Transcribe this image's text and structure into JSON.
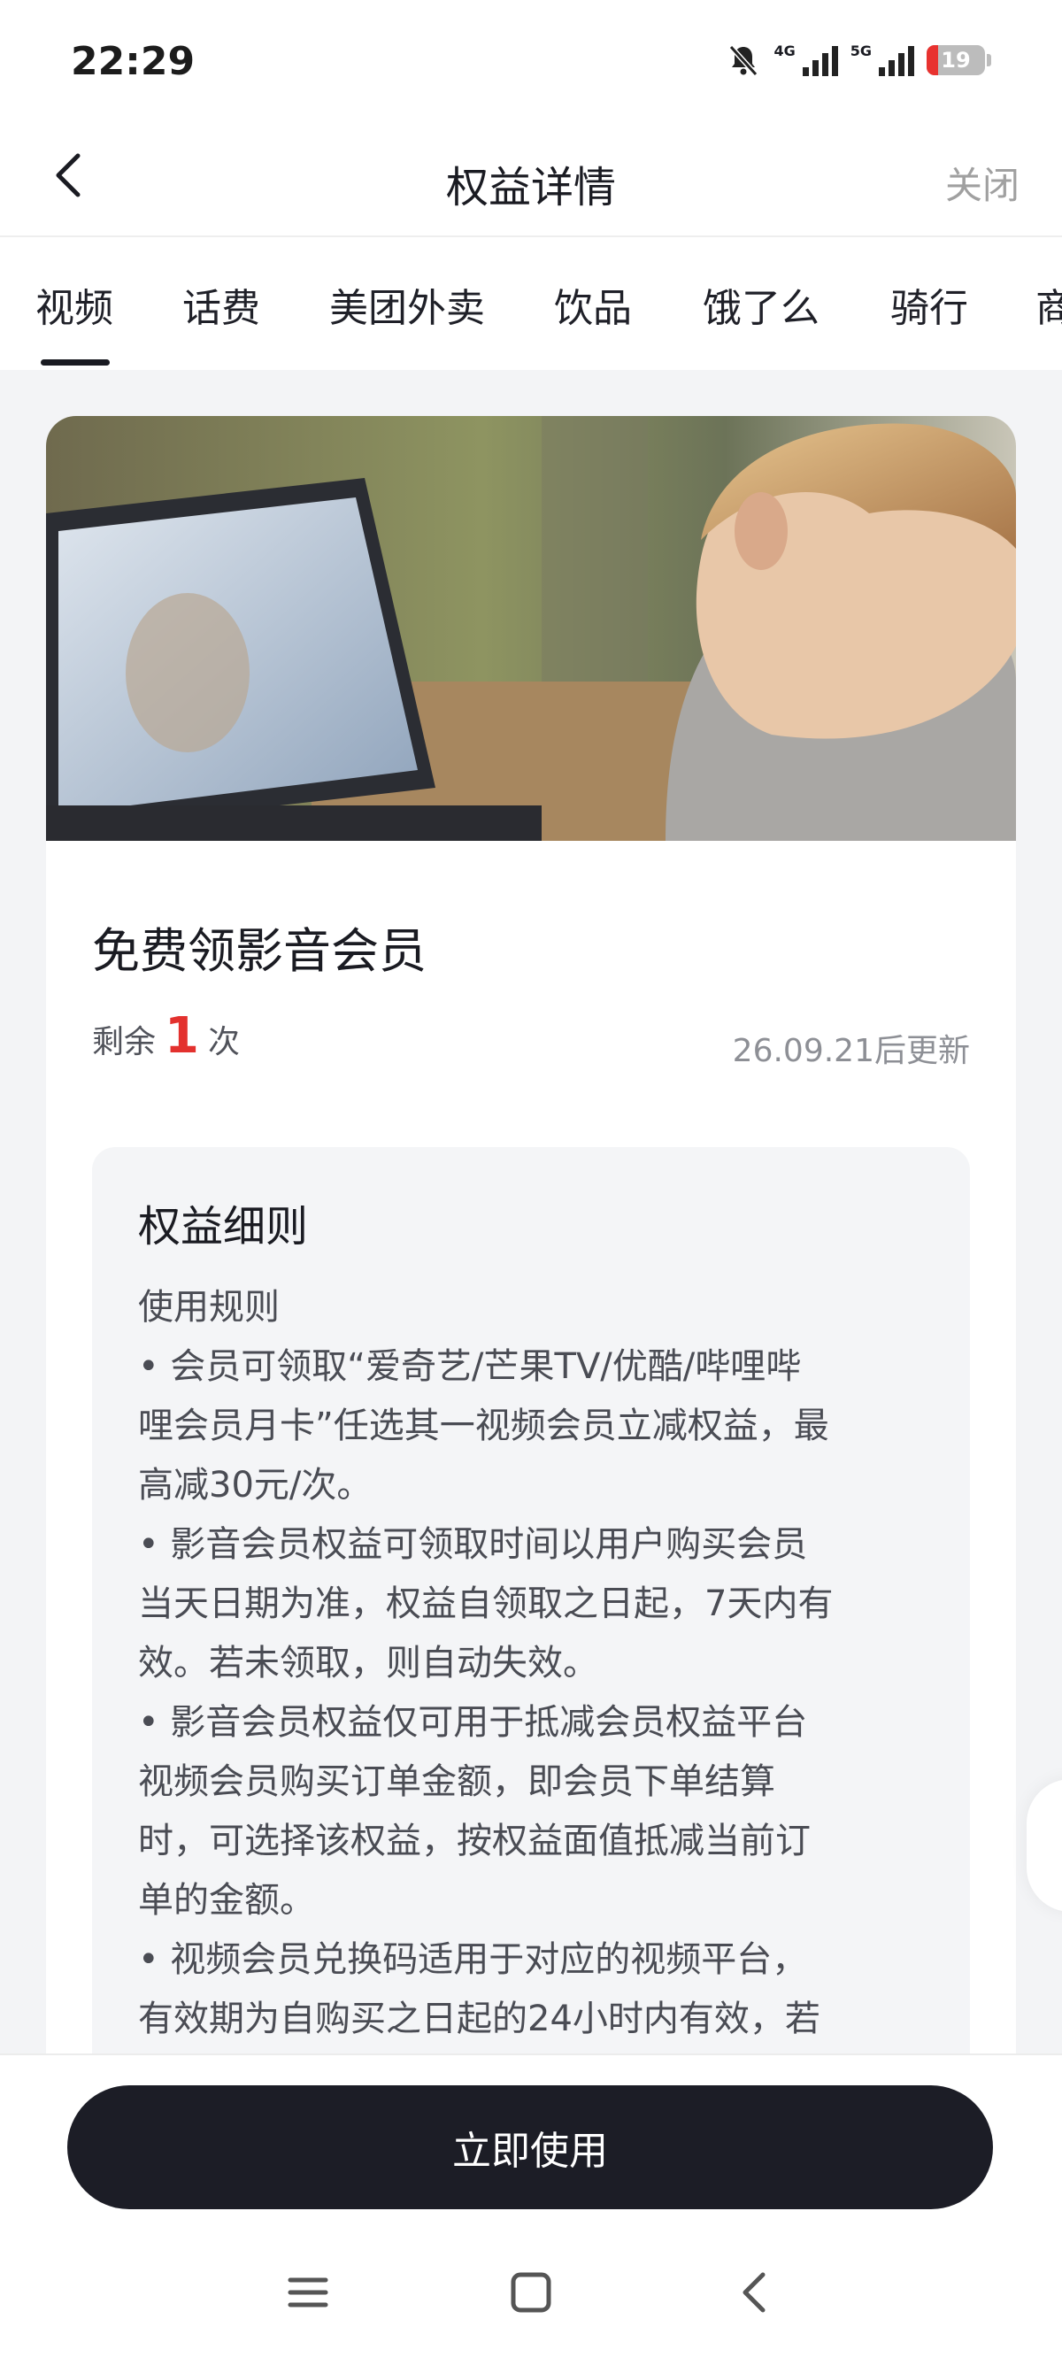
{
  "status": {
    "time": "22:29",
    "net1": "4G",
    "net2": "5G",
    "battery": "19",
    "battery_level": 0.19,
    "accent": "#e8322f"
  },
  "header": {
    "title": "权益详情",
    "close_label": "关闭"
  },
  "tabs": [
    {
      "label": "视频",
      "active": true
    },
    {
      "label": "话费"
    },
    {
      "label": "美团外卖"
    },
    {
      "label": "饮品"
    },
    {
      "label": "饿了么"
    },
    {
      "label": "骑行"
    },
    {
      "label": "商"
    }
  ],
  "card": {
    "title": "免费领影音会员",
    "remaining_prefix": "剩余",
    "remaining_count": "1",
    "remaining_suffix": "次",
    "update_text": "26.09.21后更新"
  },
  "rules": {
    "heading": "权益细则",
    "lines": [
      "使用规则",
      "• 会员可领取“爱奇艺/芒果TV/优酷/哔哩哔",
      "哩会员月卡”任选其一视频会员立减权益，最",
      "高减30元/次。",
      "• 影音会员权益可领取时间以用户购买会员",
      "当天日期为准，权益自领取之日起，7天内有",
      "效。若未领取，则自动失效。",
      "• 影音会员权益仅可用于抵减会员权益平台",
      "视频会员购买订单金额，即会员下单结算",
      "时，可选择该权益，按权益面值抵减当前订",
      "单的金额。",
      "• 视频会员兑换码适用于对应的视频平台，",
      "有效期为自购买之日起的24小时内有效，若"
    ]
  },
  "footer": {
    "cta_label": "立即使用"
  }
}
